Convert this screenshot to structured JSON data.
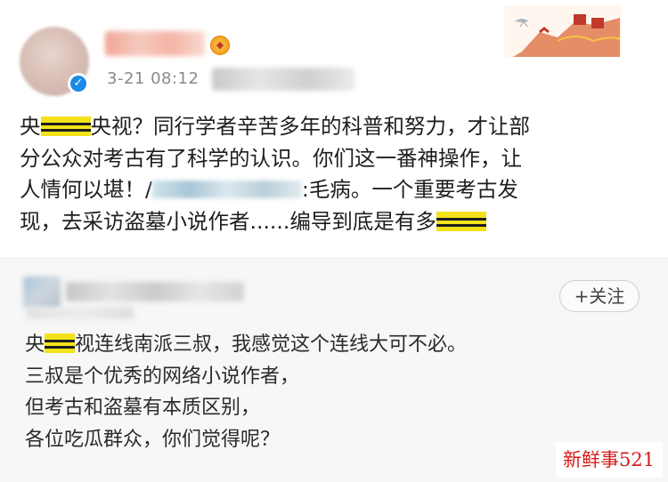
{
  "post": {
    "timestamp": "3-21 08:12",
    "lines": [
      {
        "pre": "央",
        "censored": true,
        "post": "央视？同行学者辛苦多年的科普和努力，才让部"
      },
      {
        "text": "分公众对考古有了科学的认识。你们这一番神操作，让"
      },
      {
        "pre": "人情何以堪！/",
        "blurred": true,
        "post": ":毛病。一个重要考古发"
      },
      {
        "pre": "现，去采访盗墓小说作者......编导到底是有多",
        "censored_end": true
      }
    ]
  },
  "comment": {
    "follow_label": "+关注",
    "lines": [
      {
        "pre": "央",
        "censored": true,
        "post": "视连线南派三叔，我感觉这个连线大可不必。"
      },
      {
        "text": "三叔是个优秀的网络小说作者，"
      },
      {
        "text": "但考古和盗墓有本质区别，"
      },
      {
        "text": "各位吃瓜群众，你们觉得呢？"
      }
    ]
  },
  "watermark": "新鲜事521",
  "icons": {
    "verified": "verified-badge-icon",
    "level": "level-badge-icon",
    "banner": "great-wall-banner-icon",
    "plus": "plus-icon"
  },
  "colors": {
    "censor": "#f3e11a",
    "verified": "#1a8be6",
    "watermark": "#d81b1b",
    "meta": "#8a8a8a"
  }
}
